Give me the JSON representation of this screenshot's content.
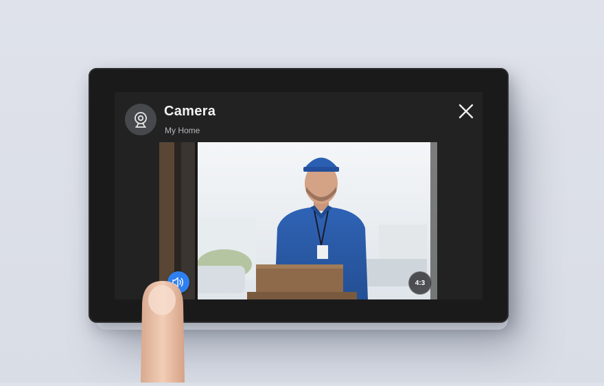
{
  "dialog": {
    "title": "Camera",
    "subtitle": "My Home",
    "close_icon": "close-icon",
    "header_icon": "webcam-icon"
  },
  "video": {
    "audio_button_icon": "speaker-icon",
    "aspect_button_label": "4:3"
  },
  "colors": {
    "accent": "#2e7ff0",
    "device_bezel": "#1a1a1b",
    "screen_bg": "#222223"
  }
}
